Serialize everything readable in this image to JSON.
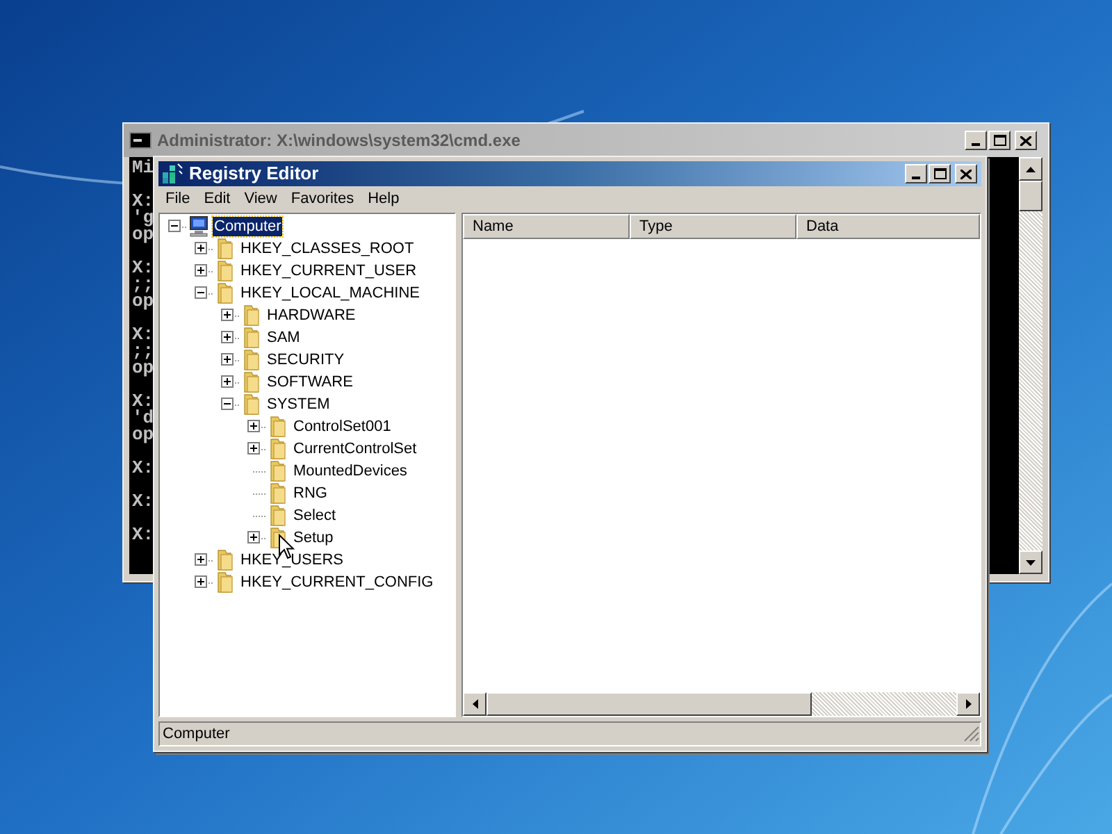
{
  "console_window": {
    "title": "Administrator: X:\\windows\\system32\\cmd.exe",
    "line_groups": [
      [
        "Mi"
      ],
      [
        "X:",
        "'g",
        "op"
      ],
      [
        "X:",
        ";;",
        "op"
      ],
      [
        "X:",
        ";;",
        "op"
      ],
      [
        "X:",
        "'d",
        "op"
      ],
      [
        "X:"
      ],
      [
        "X:"
      ],
      [
        "X:"
      ]
    ]
  },
  "registry_editor": {
    "title": "Registry Editor",
    "menu": [
      "File",
      "Edit",
      "View",
      "Favorites",
      "Help"
    ],
    "tree": [
      {
        "label": "Computer",
        "expanded": true,
        "selected": true,
        "children": [
          {
            "label": "HKEY_CLASSES_ROOT",
            "expanded": false,
            "selected": false
          },
          {
            "label": "HKEY_CURRENT_USER",
            "expanded": false,
            "selected": false
          },
          {
            "label": "HKEY_LOCAL_MACHINE",
            "expanded": true,
            "selected": false,
            "children": [
              {
                "label": "HARDWARE",
                "expanded": false,
                "selected": false
              },
              {
                "label": "SAM",
                "expanded": false,
                "selected": false
              },
              {
                "label": "SECURITY",
                "expanded": false,
                "selected": false
              },
              {
                "label": "SOFTWARE",
                "expanded": false,
                "selected": false
              },
              {
                "label": "SYSTEM",
                "expanded": true,
                "selected": false,
                "children": [
                  {
                    "label": "ControlSet001",
                    "expanded": false,
                    "selected": false
                  },
                  {
                    "label": "CurrentControlSet",
                    "expanded": false,
                    "selected": false
                  },
                  {
                    "label": "MountedDevices",
                    "selected": false
                  },
                  {
                    "label": "RNG",
                    "selected": false
                  },
                  {
                    "label": "Select",
                    "selected": false
                  },
                  {
                    "label": "Setup",
                    "expanded": false,
                    "selected": false
                  }
                ]
              }
            ]
          },
          {
            "label": "HKEY_USERS",
            "expanded": false,
            "selected": false
          },
          {
            "label": "HKEY_CURRENT_CONFIG",
            "expanded": false,
            "selected": false
          }
        ]
      }
    ],
    "columns": [
      "Name",
      "Type",
      "Data"
    ],
    "status_bar": "Computer"
  }
}
